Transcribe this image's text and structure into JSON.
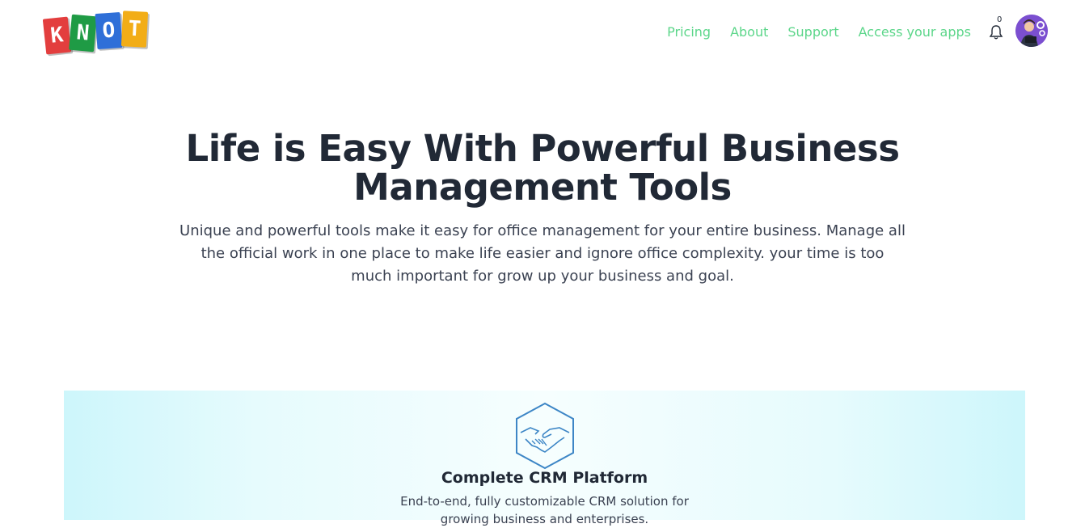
{
  "brand": {
    "letters": [
      "K",
      "N",
      "O",
      "T"
    ],
    "colors": [
      "#e33e3e",
      "#1f9b45",
      "#2f6fd8",
      "#f2ad17"
    ]
  },
  "nav": {
    "items": [
      "Pricing",
      "About",
      "Support",
      "Access your apps"
    ],
    "notification_count": "0"
  },
  "hero": {
    "title": "Life is Easy With Powerful Business Management Tools",
    "subtitle": "Unique and powerful tools make it easy for office management for your entire business. Manage all the official work in one place to make life easier and ignore office complexity. your time is too much important for grow up your business and goal."
  },
  "feature": {
    "icon": "handshake-icon",
    "title": "Complete CRM Platform",
    "description": "End-to-end, fully customizable CRM solution for growing business and enterprises."
  },
  "colors": {
    "nav_link": "#5cd68a",
    "text": "#212936",
    "feature_bg": "#cdf6fb",
    "avatar_bg": "#7b4fd0"
  }
}
